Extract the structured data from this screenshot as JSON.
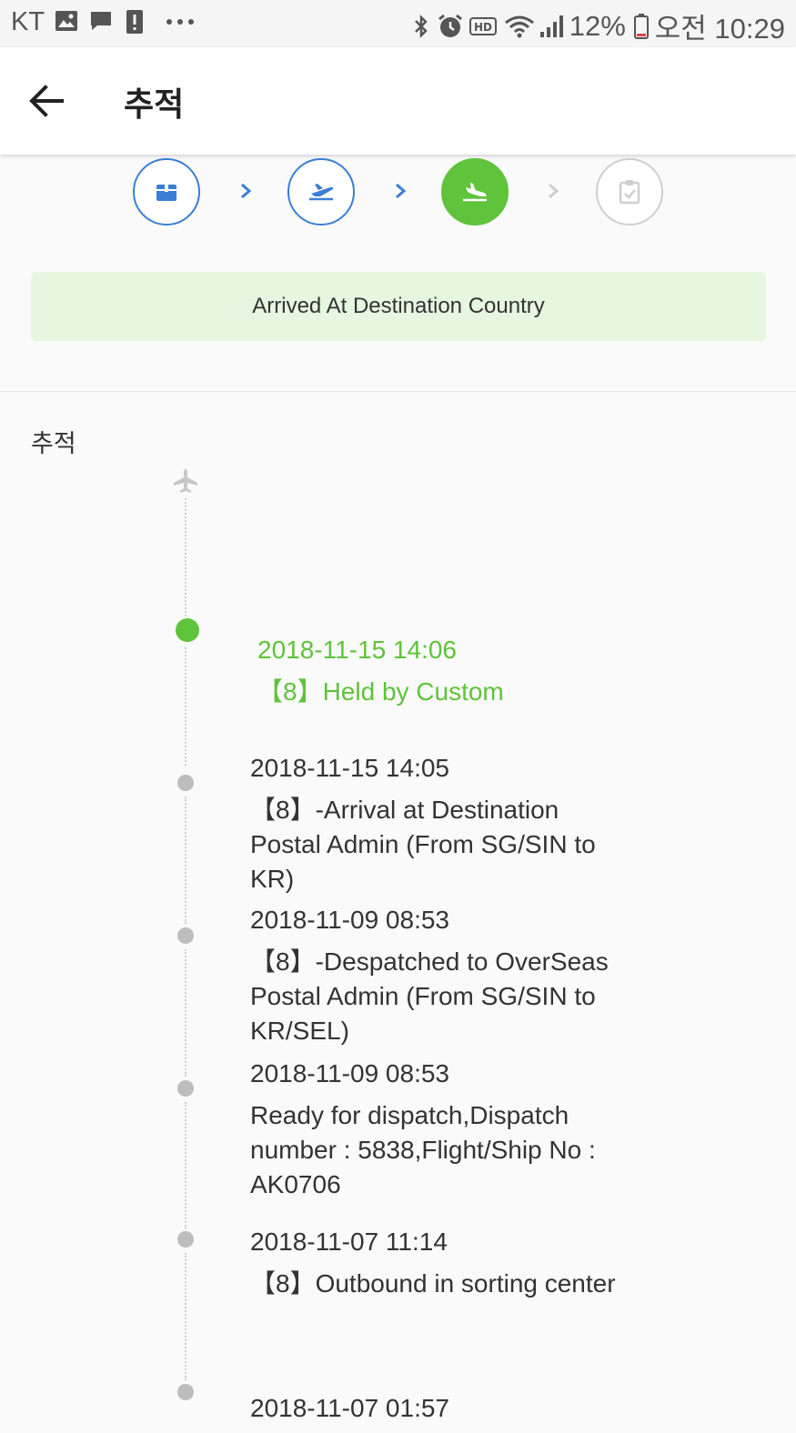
{
  "status_bar": {
    "carrier": "KT",
    "battery": "12%",
    "time": "오전 10:29"
  },
  "app_bar": {
    "title": "추적"
  },
  "stepper": {
    "steps": [
      {
        "icon": "package-icon",
        "state": "done"
      },
      {
        "icon": "plane-takeoff-icon",
        "state": "done"
      },
      {
        "icon": "plane-landing-icon",
        "state": "active"
      },
      {
        "icon": "clipboard-check-icon",
        "state": "pending"
      }
    ]
  },
  "banner": {
    "text": "Arrived At Destination Country"
  },
  "section": {
    "title": "추적"
  },
  "timeline": [
    {
      "time": "2018-11-15 14:06",
      "desc": "【8】Held by Custom",
      "active": true
    },
    {
      "time": "2018-11-15 14:05",
      "desc": "【8】-Arrival at Destination Postal Admin (From SG/SIN to KR)",
      "active": false
    },
    {
      "time": "2018-11-09 08:53",
      "desc": "【8】-Despatched to OverSeas Postal Admin (From SG/SIN to KR/SEL)",
      "active": false
    },
    {
      "time": "2018-11-09 08:53",
      "desc": "Ready for dispatch,Dispatch number : 5838,Flight/Ship No : AK0706",
      "active": false
    },
    {
      "time": "2018-11-07 11:14",
      "desc": "【8】Outbound in sorting center",
      "active": false
    },
    {
      "time": "2018-11-07 01:57",
      "desc": "",
      "active": false
    }
  ],
  "colors": {
    "accent_green": "#5fc33b",
    "accent_blue": "#3a7fd5",
    "banner_bg": "#e6f6e1"
  }
}
